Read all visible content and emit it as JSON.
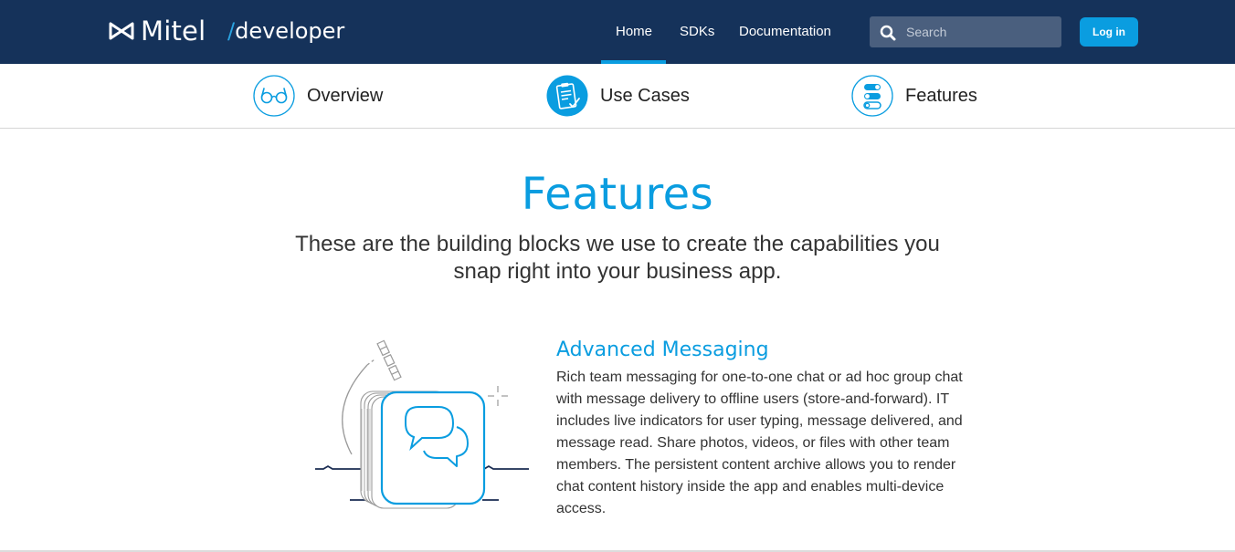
{
  "brand": {
    "name": "Mitel",
    "slash": "/",
    "developer": "developer"
  },
  "nav": {
    "links": [
      "Home",
      "SDKs",
      "Documentation"
    ],
    "search_placeholder": "Search",
    "login_label": "Log in"
  },
  "subnav": {
    "items": [
      {
        "label": "Overview",
        "icon": "glasses-icon"
      },
      {
        "label": "Use Cases",
        "icon": "clipboard-icon"
      },
      {
        "label": "Features",
        "icon": "toggles-icon"
      }
    ]
  },
  "page": {
    "title": "Features",
    "subtitle": "These are the building blocks we use to create the capabilities you snap right into your business app."
  },
  "feature": {
    "icon": "chat-bubbles-icon",
    "title": "Advanced Messaging",
    "description": "Rich team messaging for one-to-one chat or ad hoc group chat with message delivery to offline users (store-and-forward). IT includes live indicators for user typing, message delivered, and message read. Share photos, videos, or files with other team members. The persistent content archive allows you to render chat content history inside the app and enables multi-device access."
  },
  "colors": {
    "navy": "#15325a",
    "accent": "#0a9de0"
  }
}
